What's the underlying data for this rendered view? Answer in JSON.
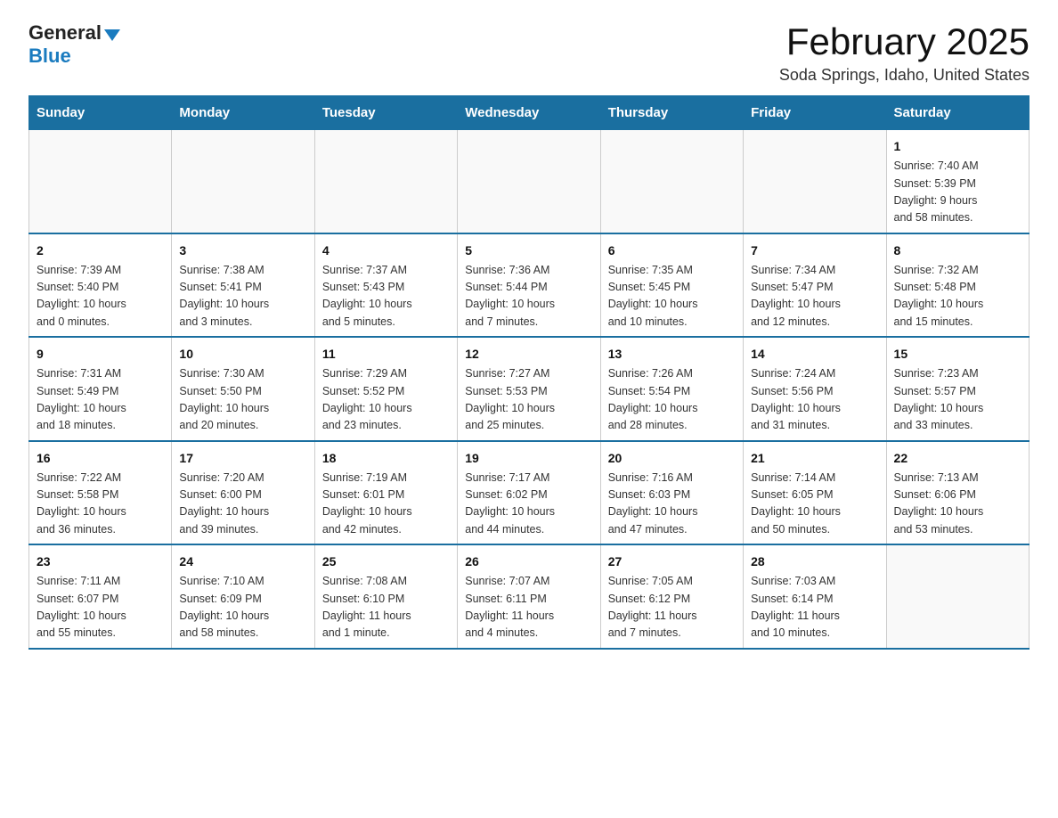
{
  "header": {
    "logo_general": "General",
    "logo_blue": "Blue",
    "title": "February 2025",
    "location": "Soda Springs, Idaho, United States"
  },
  "weekdays": [
    "Sunday",
    "Monday",
    "Tuesday",
    "Wednesday",
    "Thursday",
    "Friday",
    "Saturday"
  ],
  "weeks": [
    [
      {
        "day": "",
        "info": ""
      },
      {
        "day": "",
        "info": ""
      },
      {
        "day": "",
        "info": ""
      },
      {
        "day": "",
        "info": ""
      },
      {
        "day": "",
        "info": ""
      },
      {
        "day": "",
        "info": ""
      },
      {
        "day": "1",
        "info": "Sunrise: 7:40 AM\nSunset: 5:39 PM\nDaylight: 9 hours\nand 58 minutes."
      }
    ],
    [
      {
        "day": "2",
        "info": "Sunrise: 7:39 AM\nSunset: 5:40 PM\nDaylight: 10 hours\nand 0 minutes."
      },
      {
        "day": "3",
        "info": "Sunrise: 7:38 AM\nSunset: 5:41 PM\nDaylight: 10 hours\nand 3 minutes."
      },
      {
        "day": "4",
        "info": "Sunrise: 7:37 AM\nSunset: 5:43 PM\nDaylight: 10 hours\nand 5 minutes."
      },
      {
        "day": "5",
        "info": "Sunrise: 7:36 AM\nSunset: 5:44 PM\nDaylight: 10 hours\nand 7 minutes."
      },
      {
        "day": "6",
        "info": "Sunrise: 7:35 AM\nSunset: 5:45 PM\nDaylight: 10 hours\nand 10 minutes."
      },
      {
        "day": "7",
        "info": "Sunrise: 7:34 AM\nSunset: 5:47 PM\nDaylight: 10 hours\nand 12 minutes."
      },
      {
        "day": "8",
        "info": "Sunrise: 7:32 AM\nSunset: 5:48 PM\nDaylight: 10 hours\nand 15 minutes."
      }
    ],
    [
      {
        "day": "9",
        "info": "Sunrise: 7:31 AM\nSunset: 5:49 PM\nDaylight: 10 hours\nand 18 minutes."
      },
      {
        "day": "10",
        "info": "Sunrise: 7:30 AM\nSunset: 5:50 PM\nDaylight: 10 hours\nand 20 minutes."
      },
      {
        "day": "11",
        "info": "Sunrise: 7:29 AM\nSunset: 5:52 PM\nDaylight: 10 hours\nand 23 minutes."
      },
      {
        "day": "12",
        "info": "Sunrise: 7:27 AM\nSunset: 5:53 PM\nDaylight: 10 hours\nand 25 minutes."
      },
      {
        "day": "13",
        "info": "Sunrise: 7:26 AM\nSunset: 5:54 PM\nDaylight: 10 hours\nand 28 minutes."
      },
      {
        "day": "14",
        "info": "Sunrise: 7:24 AM\nSunset: 5:56 PM\nDaylight: 10 hours\nand 31 minutes."
      },
      {
        "day": "15",
        "info": "Sunrise: 7:23 AM\nSunset: 5:57 PM\nDaylight: 10 hours\nand 33 minutes."
      }
    ],
    [
      {
        "day": "16",
        "info": "Sunrise: 7:22 AM\nSunset: 5:58 PM\nDaylight: 10 hours\nand 36 minutes."
      },
      {
        "day": "17",
        "info": "Sunrise: 7:20 AM\nSunset: 6:00 PM\nDaylight: 10 hours\nand 39 minutes."
      },
      {
        "day": "18",
        "info": "Sunrise: 7:19 AM\nSunset: 6:01 PM\nDaylight: 10 hours\nand 42 minutes."
      },
      {
        "day": "19",
        "info": "Sunrise: 7:17 AM\nSunset: 6:02 PM\nDaylight: 10 hours\nand 44 minutes."
      },
      {
        "day": "20",
        "info": "Sunrise: 7:16 AM\nSunset: 6:03 PM\nDaylight: 10 hours\nand 47 minutes."
      },
      {
        "day": "21",
        "info": "Sunrise: 7:14 AM\nSunset: 6:05 PM\nDaylight: 10 hours\nand 50 minutes."
      },
      {
        "day": "22",
        "info": "Sunrise: 7:13 AM\nSunset: 6:06 PM\nDaylight: 10 hours\nand 53 minutes."
      }
    ],
    [
      {
        "day": "23",
        "info": "Sunrise: 7:11 AM\nSunset: 6:07 PM\nDaylight: 10 hours\nand 55 minutes."
      },
      {
        "day": "24",
        "info": "Sunrise: 7:10 AM\nSunset: 6:09 PM\nDaylight: 10 hours\nand 58 minutes."
      },
      {
        "day": "25",
        "info": "Sunrise: 7:08 AM\nSunset: 6:10 PM\nDaylight: 11 hours\nand 1 minute."
      },
      {
        "day": "26",
        "info": "Sunrise: 7:07 AM\nSunset: 6:11 PM\nDaylight: 11 hours\nand 4 minutes."
      },
      {
        "day": "27",
        "info": "Sunrise: 7:05 AM\nSunset: 6:12 PM\nDaylight: 11 hours\nand 7 minutes."
      },
      {
        "day": "28",
        "info": "Sunrise: 7:03 AM\nSunset: 6:14 PM\nDaylight: 11 hours\nand 10 minutes."
      },
      {
        "day": "",
        "info": ""
      }
    ]
  ]
}
